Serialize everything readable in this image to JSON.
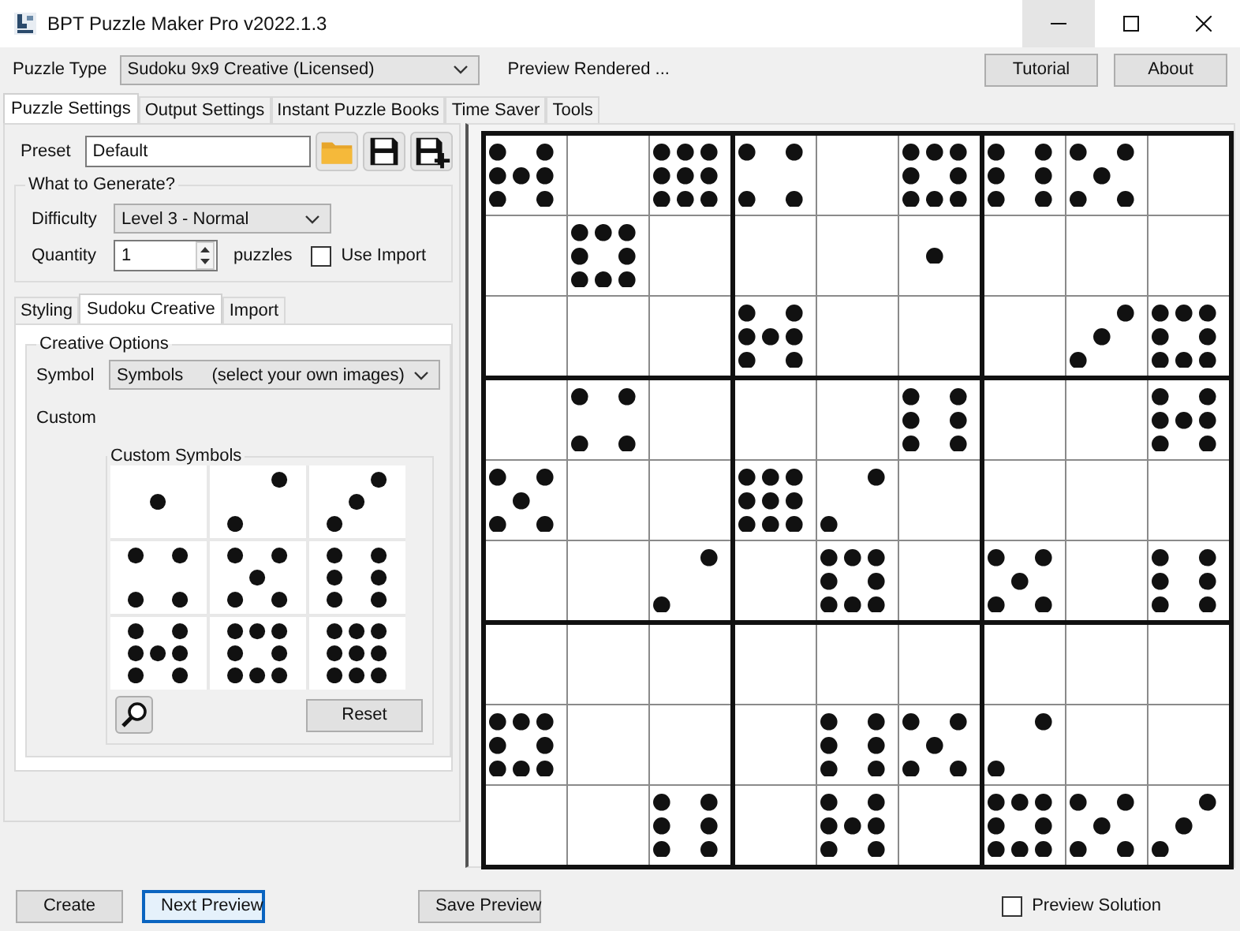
{
  "window": {
    "title": "BPT Puzzle Maker Pro v2022.1.3",
    "controls": [
      {
        "kind": "minimize",
        "hovered": true
      },
      {
        "kind": "maximize",
        "hovered": false
      },
      {
        "kind": "close",
        "hovered": false
      }
    ]
  },
  "toolbar": {
    "puzzle_type_label": "Puzzle Type",
    "puzzle_type": "Sudoku 9x9 Creative (Licensed)",
    "status": "Preview Rendered ...",
    "buttons": [
      "Tutorial",
      "About"
    ]
  },
  "tabs": [
    {
      "label": "Puzzle Settings",
      "selected": true
    },
    {
      "label": "Output Settings",
      "selected": false
    },
    {
      "label": "Instant Puzzle Books",
      "selected": false
    },
    {
      "label": "Time Saver",
      "selected": false
    },
    {
      "label": "Tools",
      "selected": false
    }
  ],
  "preset": {
    "label": "Preset",
    "value": "Default"
  },
  "generate": {
    "title": "What to Generate?",
    "difficulty_label": "Difficulty",
    "difficulty": "Level 3 - Normal",
    "quantity_label": "Quantity",
    "quantity": "1",
    "quantity_unit": "puzzles",
    "use_import": {
      "label": "Use Import",
      "checked": false
    }
  },
  "sub_tabs": [
    {
      "label": "Styling",
      "selected": false
    },
    {
      "label": "Sudoku Creative",
      "selected": true
    },
    {
      "label": "Import",
      "selected": false
    }
  ],
  "creative": {
    "title": "Creative Options",
    "symbol_label": "Symbol",
    "symbol": "Symbols",
    "symbol_hint": "(select your own images)",
    "custom_label": "Custom",
    "custom_symbols_title": "Custom Symbols",
    "custom_symbols": [
      {
        "kind": "one"
      },
      {
        "kind": "two"
      },
      {
        "kind": "three"
      },
      {
        "kind": "four"
      },
      {
        "kind": "five"
      },
      {
        "kind": "six"
      },
      {
        "kind": "seven"
      },
      {
        "kind": "eight"
      },
      {
        "kind": "nine"
      }
    ],
    "reset": "Reset"
  },
  "grid": {
    "rows": [
      [
        {
          "kind": "seven"
        },
        {
          "kind": "blank"
        },
        {
          "kind": "nine"
        },
        {
          "kind": "four"
        },
        {
          "kind": "blank"
        },
        {
          "kind": "eight"
        },
        {
          "kind": "six"
        },
        {
          "kind": "five"
        },
        {
          "kind": "blank"
        }
      ],
      [
        {
          "kind": "blank"
        },
        {
          "kind": "eight"
        },
        {
          "kind": "blank"
        },
        {
          "kind": "blank"
        },
        {
          "kind": "blank"
        },
        {
          "kind": "one"
        },
        {
          "kind": "blank"
        },
        {
          "kind": "blank"
        },
        {
          "kind": "blank"
        }
      ],
      [
        {
          "kind": "blank"
        },
        {
          "kind": "blank"
        },
        {
          "kind": "blank"
        },
        {
          "kind": "seven"
        },
        {
          "kind": "blank"
        },
        {
          "kind": "blank"
        },
        {
          "kind": "blank"
        },
        {
          "kind": "three"
        },
        {
          "kind": "eight"
        }
      ],
      [
        {
          "kind": "blank"
        },
        {
          "kind": "four"
        },
        {
          "kind": "blank"
        },
        {
          "kind": "blank"
        },
        {
          "kind": "blank"
        },
        {
          "kind": "six"
        },
        {
          "kind": "blank"
        },
        {
          "kind": "blank"
        },
        {
          "kind": "seven"
        }
      ],
      [
        {
          "kind": "five"
        },
        {
          "kind": "blank"
        },
        {
          "kind": "blank"
        },
        {
          "kind": "nine"
        },
        {
          "kind": "two"
        },
        {
          "kind": "blank"
        },
        {
          "kind": "blank"
        },
        {
          "kind": "blank"
        },
        {
          "kind": "blank"
        }
      ],
      [
        {
          "kind": "blank"
        },
        {
          "kind": "blank"
        },
        {
          "kind": "two"
        },
        {
          "kind": "blank"
        },
        {
          "kind": "eight"
        },
        {
          "kind": "blank"
        },
        {
          "kind": "five"
        },
        {
          "kind": "blank"
        },
        {
          "kind": "six"
        }
      ],
      [
        {
          "kind": "blank"
        },
        {
          "kind": "blank"
        },
        {
          "kind": "blank"
        },
        {
          "kind": "blank"
        },
        {
          "kind": "blank"
        },
        {
          "kind": "blank"
        },
        {
          "kind": "blank"
        },
        {
          "kind": "blank"
        },
        {
          "kind": "blank"
        }
      ],
      [
        {
          "kind": "eight"
        },
        {
          "kind": "blank"
        },
        {
          "kind": "blank"
        },
        {
          "kind": "blank"
        },
        {
          "kind": "six"
        },
        {
          "kind": "five"
        },
        {
          "kind": "two"
        },
        {
          "kind": "blank"
        },
        {
          "kind": "blank"
        }
      ],
      [
        {
          "kind": "blank"
        },
        {
          "kind": "blank"
        },
        {
          "kind": "six"
        },
        {
          "kind": "blank"
        },
        {
          "kind": "seven"
        },
        {
          "kind": "blank"
        },
        {
          "kind": "eight"
        },
        {
          "kind": "five"
        },
        {
          "kind": "three"
        }
      ]
    ]
  },
  "bottom": {
    "buttons": [
      {
        "label": "Create",
        "focused": false
      },
      {
        "label": "Next Preview",
        "focused": true
      },
      {
        "label": "Save Preview",
        "focused": false
      }
    ],
    "preview_solution": {
      "label": "Preview Solution",
      "checked": false
    }
  }
}
